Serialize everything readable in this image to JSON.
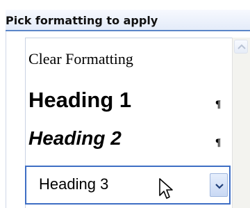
{
  "panel": {
    "title": "Pick formatting to apply"
  },
  "styles": {
    "items": [
      {
        "label": "Clear Formatting",
        "mark": ""
      },
      {
        "label": "Heading 1",
        "mark": "¶"
      },
      {
        "label": "Heading 2",
        "mark": "¶"
      },
      {
        "label": "Heading 3",
        "mark": "",
        "selected": true
      }
    ]
  },
  "icons": {
    "scroll_up": "chevron-up-icon",
    "dropdown": "chevron-down-icon",
    "cursor": "mouse-pointer-icon",
    "paragraph_mark": "pilcrow-icon"
  },
  "colors": {
    "accent": "#3e6ec4",
    "header_bg": "#e3ebf9"
  }
}
